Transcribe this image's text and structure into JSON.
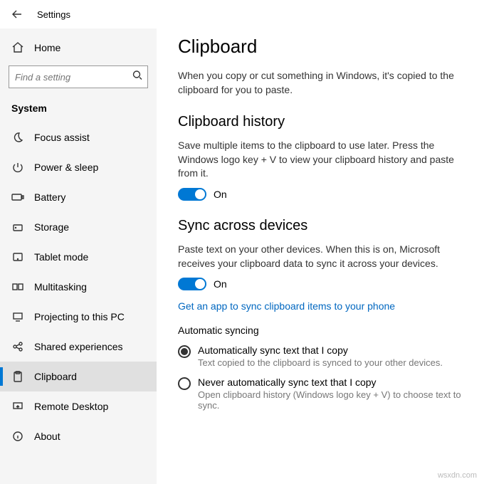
{
  "titlebar": {
    "title": "Settings"
  },
  "sidebar": {
    "home": "Home",
    "search_placeholder": "Find a setting",
    "section": "System",
    "items": [
      {
        "label": "Focus assist"
      },
      {
        "label": "Power & sleep"
      },
      {
        "label": "Battery"
      },
      {
        "label": "Storage"
      },
      {
        "label": "Tablet mode"
      },
      {
        "label": "Multitasking"
      },
      {
        "label": "Projecting to this PC"
      },
      {
        "label": "Shared experiences"
      },
      {
        "label": "Clipboard"
      },
      {
        "label": "Remote Desktop"
      },
      {
        "label": "About"
      }
    ]
  },
  "content": {
    "title": "Clipboard",
    "intro": "When you copy or cut something in Windows, it's copied to the clipboard for you to paste.",
    "history": {
      "heading": "Clipboard history",
      "desc": "Save multiple items to the clipboard to use later. Press the Windows logo key + V to view your clipboard history and paste from it.",
      "toggle_label": "On"
    },
    "sync": {
      "heading": "Sync across devices",
      "desc": "Paste text on your other devices. When this is on, Microsoft receives your clipboard data to sync it across your devices.",
      "toggle_label": "On",
      "link": "Get an app to sync clipboard items to your phone",
      "auto_heading": "Automatic syncing",
      "options": [
        {
          "label": "Automatically sync text that I copy",
          "sub": "Text copied to the clipboard is synced to your other devices."
        },
        {
          "label": "Never automatically sync text that I copy",
          "sub": "Open clipboard history (Windows logo key + V) to choose text to sync."
        }
      ]
    }
  },
  "watermark": "wsxdn.com"
}
